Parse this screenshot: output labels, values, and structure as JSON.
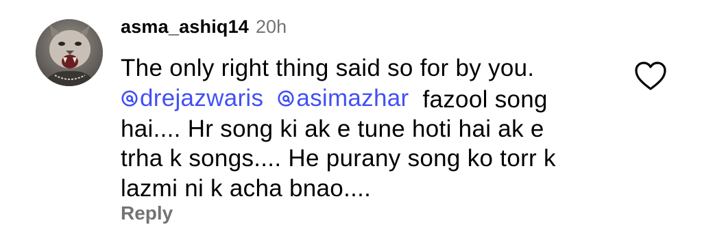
{
  "comment": {
    "username": "asma_ashiq14",
    "timestamp": "20h",
    "text_line1": "The only right thing said so for by you.",
    "mentions": [
      "dreјazwaris",
      "asimazhar"
    ],
    "text_after_mentions": "fazool song",
    "text_line3": "hai.... Hr song ki ak e tune hoti hai ak e",
    "text_line4": "trha k songs.... He purany song ko torr k",
    "text_line5": "lazmi ni k acha bnao....",
    "reply_label": "Reply"
  },
  "icons": {
    "avatar": "cougar-avatar",
    "mention": "threads-at-icon",
    "like": "heart-outline-icon"
  },
  "colors": {
    "mention": "#4150f7",
    "muted": "#737373",
    "text": "#000000"
  }
}
